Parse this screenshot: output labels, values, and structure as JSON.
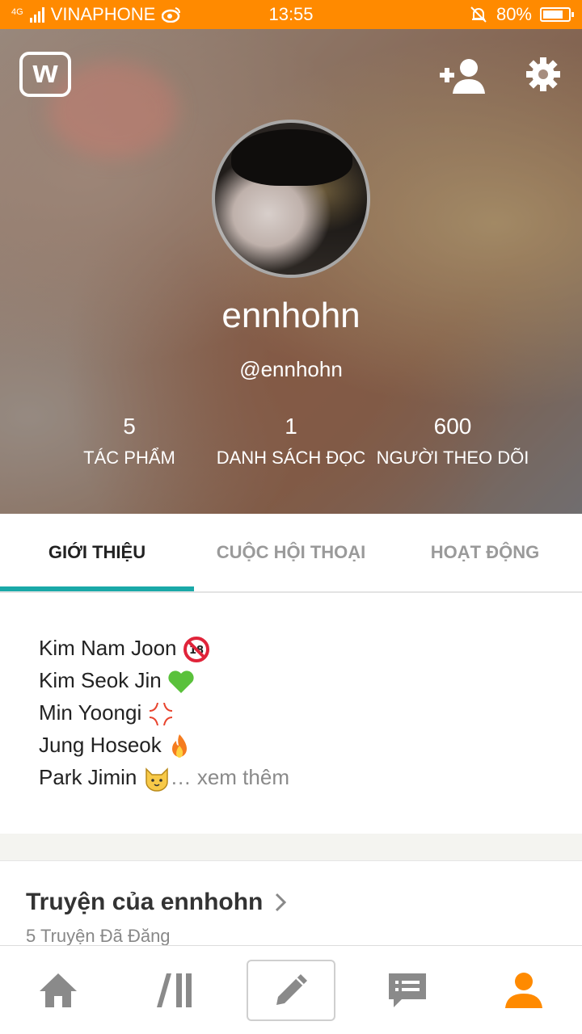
{
  "statusbar": {
    "network_type": "4G",
    "carrier": "VINAPHONE",
    "time": "13:55",
    "battery_percent": "80%",
    "battery_level": 0.8
  },
  "header": {
    "logo_letter": "w",
    "profile": {
      "display_name": "ennhohn",
      "username": "@ennhohn"
    },
    "stats": [
      {
        "value": "5",
        "label": "TÁC PHẨM"
      },
      {
        "value": "1",
        "label": "DANH SÁCH ĐỌC"
      },
      {
        "value": "600",
        "label": "NGƯỜI THEO DÕI"
      }
    ]
  },
  "tabs": [
    {
      "label": "GIỚI THIỆU",
      "active": true
    },
    {
      "label": "CUỘC HỘI THOẠI",
      "active": false
    },
    {
      "label": "HOẠT ĐỘNG",
      "active": false
    }
  ],
  "about": {
    "lines": [
      {
        "text": "Kim Nam Joon",
        "icon": "no-under-18-icon"
      },
      {
        "text": "Kim Seok Jin",
        "icon": "green-heart-icon"
      },
      {
        "text": "Min Yoongi",
        "icon": "anger-icon"
      },
      {
        "text": "Jung Hoseok",
        "icon": "fire-icon"
      },
      {
        "text": "Park Jimin",
        "icon": "cat-face-icon"
      }
    ],
    "ellipsis": "…",
    "more_label": "xem thêm"
  },
  "stories": {
    "title": "Truyện của ennhohn",
    "subtitle": "5 Truyện Đã Đăng"
  },
  "bottom_nav": [
    {
      "icon": "home-icon"
    },
    {
      "icon": "library-icon"
    },
    {
      "icon": "pencil-icon"
    },
    {
      "icon": "messages-icon"
    },
    {
      "icon": "profile-icon",
      "active": true
    }
  ],
  "colors": {
    "statusbar": "#ff8a00",
    "accent": "#1aa9a8",
    "nav_active": "#ff8a00",
    "nav_inactive": "#8a8a8a"
  }
}
